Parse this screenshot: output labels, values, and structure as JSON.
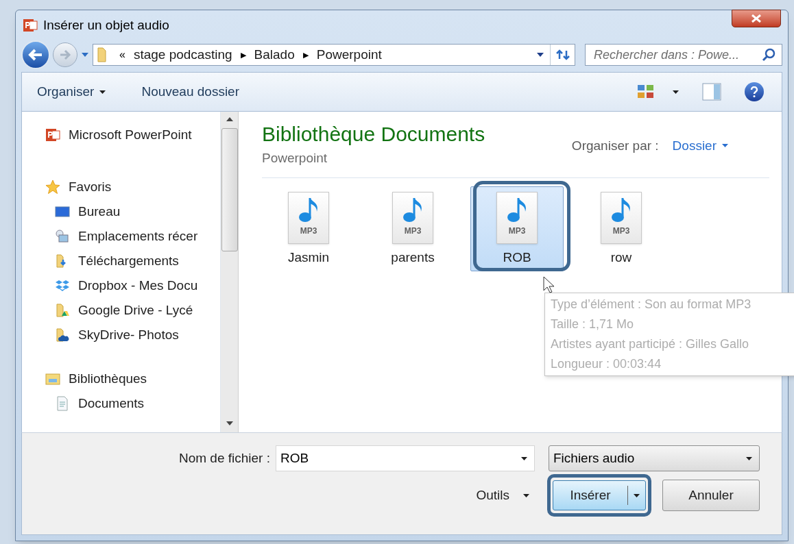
{
  "window": {
    "title": "Insérer un objet audio"
  },
  "address": {
    "overflow": "«",
    "crumbs": [
      "stage podcasting",
      "Balado",
      "Powerpoint"
    ],
    "separator": "▶"
  },
  "search": {
    "placeholder": "Rechercher dans : Powe..."
  },
  "toolbar": {
    "organize": "Organiser",
    "new_folder": "Nouveau dossier"
  },
  "sidebar": {
    "items": [
      {
        "label": "Microsoft PowerPoint",
        "kind": "app"
      },
      {
        "label": "Favoris",
        "kind": "star",
        "children": [
          {
            "label": "Bureau",
            "kind": "desktop"
          },
          {
            "label": "Emplacements récer",
            "kind": "recent"
          },
          {
            "label": "Téléchargements",
            "kind": "download"
          },
          {
            "label": "Dropbox - Mes Docu",
            "kind": "dropbox"
          },
          {
            "label": "Google Drive - Lycé",
            "kind": "drive"
          },
          {
            "label": "SkyDrive- Photos",
            "kind": "cloud"
          }
        ]
      },
      {
        "label": "Bibliothèques",
        "kind": "library",
        "children": [
          {
            "label": "Documents",
            "kind": "document"
          }
        ]
      }
    ]
  },
  "library": {
    "title": "Bibliothèque Documents",
    "subtitle": "Powerpoint",
    "arrange_label": "Organiser par :",
    "arrange_value": "Dossier"
  },
  "files": [
    {
      "name": "Jasmin",
      "badge": "MP3",
      "selected": false
    },
    {
      "name": "parents",
      "badge": "MP3",
      "selected": false
    },
    {
      "name": "ROB",
      "badge": "MP3",
      "selected": true
    },
    {
      "name": "row",
      "badge": "MP3",
      "selected": false
    }
  ],
  "tooltip": {
    "lines": [
      "Type d’élément : Son au format MP3",
      "Taille : 1,71 Mo",
      "Artistes ayant participé : Gilles Gallo",
      "Longueur : 00:03:44"
    ]
  },
  "footer": {
    "filename_label": "Nom de fichier :",
    "filename": "ROB",
    "filter": "Fichiers audio",
    "tools": "Outils",
    "buttons": [
      {
        "label": "Insérer",
        "kind": "split",
        "annotated": true
      },
      {
        "label": "Annuler",
        "kind": "plain",
        "annotated": false
      }
    ]
  }
}
